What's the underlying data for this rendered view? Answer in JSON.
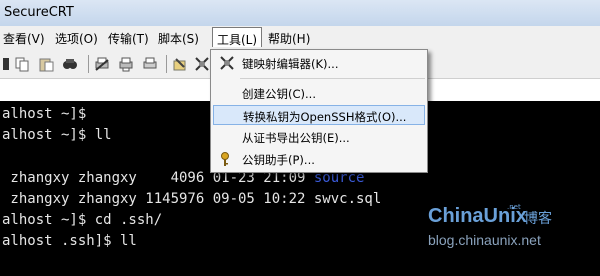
{
  "window": {
    "title": "SecureCRT"
  },
  "menubar": {
    "items": [
      {
        "label": "查看(V)"
      },
      {
        "label": "选项(O)"
      },
      {
        "label": "传输(T)"
      },
      {
        "label": "脚本(S)"
      },
      {
        "label": "工具(L)"
      },
      {
        "label": "帮助(H)"
      }
    ]
  },
  "toolbar": {
    "icons": [
      "partial-icon",
      "copy-icon",
      "paste-icon",
      "find-icon",
      "print-setup-icon",
      "print-preview-icon",
      "print-icon",
      "options-icon",
      "keymap-icon",
      "tools-icon"
    ]
  },
  "tools_menu": {
    "items": [
      {
        "label": "键映射编辑器(K)...",
        "icon": "keymap-editor-icon"
      },
      {
        "label": "创建公钥(C)..."
      },
      {
        "label": "转换私钥为OpenSSH格式(O)...",
        "highlighted": true
      },
      {
        "label": "从证书导出公钥(E)..."
      },
      {
        "label": "公钥助手(P)...",
        "icon": "key-icon"
      }
    ]
  },
  "terminal": {
    "lines": [
      {
        "text": "alhost ~]$"
      },
      {
        "text": "alhost ~]$ ll"
      },
      {
        "text": ""
      },
      {
        "text": " zhangxy zhangxy    4096 01-23 21:09 ",
        "colored": "source"
      },
      {
        "text": " zhangxy zhangxy 1145976 09-05 10:22 swvc.sql"
      },
      {
        "text": "alhost ~]$ cd .ssh/"
      },
      {
        "text": "alhost .ssh]$ ll"
      }
    ],
    "colors": {
      "dir": "#3b5bd9",
      "text": "#e6e6e6"
    }
  },
  "watermark": {
    "brand": "ChinaUnix",
    "small": ".net",
    "cn": "博客",
    "url": "blog.chinaunix.net"
  }
}
